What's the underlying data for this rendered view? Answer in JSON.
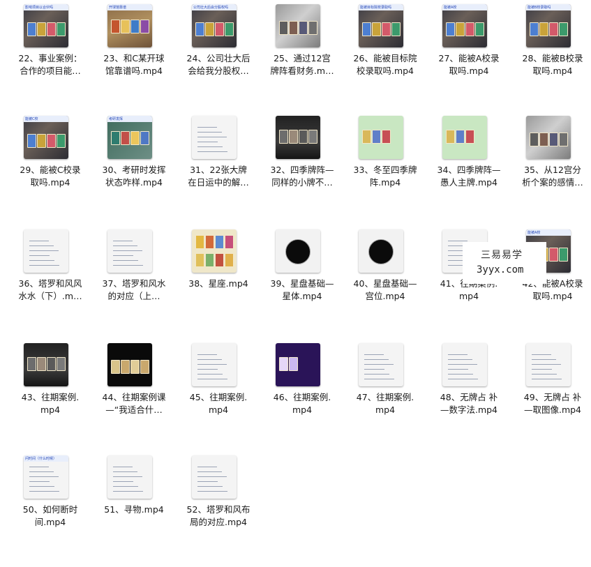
{
  "files": [
    {
      "l1": "22、事业案例：",
      "l2": "合作的项目能…",
      "thumb": "cards-blue",
      "banner": "影响项目以合伙吗"
    },
    {
      "l1": "23、和C某开球",
      "l2": "馆靠谱吗.mp4",
      "thumb": "cards-wood",
      "banner": "开球馆靠谱"
    },
    {
      "l1": "24、公司壮大后",
      "l2": "会给我分股权…",
      "thumb": "cards-blue",
      "banner": "公司壮大后会分股权吗"
    },
    {
      "l1": "25、通过12宫",
      "l2": "牌阵看财务.m…",
      "thumb": "photo-gray",
      "banner": ""
    },
    {
      "l1": "26、能被目标院",
      "l2": "校录取吗.mp4",
      "thumb": "cards-blue",
      "banner": "能被目标院校录取吗"
    },
    {
      "l1": "27、能被A校录",
      "l2": "取吗.mp4",
      "thumb": "cards-blue",
      "banner": "能被A校"
    },
    {
      "l1": "28、能被B校录",
      "l2": "取吗.mp4",
      "thumb": "cards-blue",
      "banner": "能被B校录取吗"
    },
    {
      "l1": "29、能被C校录",
      "l2": "取吗.mp4",
      "thumb": "cards-blue",
      "banner": "能被C校"
    },
    {
      "l1": "30、考研时发挥",
      "l2": "状态咋样.mp4",
      "thumb": "cards-green",
      "banner": "考研发挥"
    },
    {
      "l1": "31、22张大牌",
      "l2": "在日运中的解…",
      "thumb": "doc",
      "banner": ""
    },
    {
      "l1": "32、四季牌阵—",
      "l2": "同样的小牌不…",
      "thumb": "dark",
      "banner": ""
    },
    {
      "l1": "33、冬至四季牌",
      "l2": "阵.mp4",
      "thumb": "green",
      "banner": ""
    },
    {
      "l1": "34、四季牌阵—",
      "l2": "愚人主牌.mp4",
      "thumb": "green",
      "banner": ""
    },
    {
      "l1": "35、从12宫分",
      "l2": "析个案的感情…",
      "thumb": "photo-gray",
      "banner": ""
    },
    {
      "l1": "36、塔罗和风风",
      "l2": "水水（下）.m…",
      "thumb": "doc",
      "banner": ""
    },
    {
      "l1": "37、塔罗和风水",
      "l2": "的对应（上…",
      "thumb": "doc",
      "banner": ""
    },
    {
      "l1": "38、星座.mp4",
      "l2": "",
      "thumb": "cards-yellow",
      "banner": ""
    },
    {
      "l1": "39、星盘基础—",
      "l2": "星体.mp4",
      "thumb": "chart-dark",
      "banner": ""
    },
    {
      "l1": "40、星盘基础—",
      "l2": "宫位.mp4",
      "thumb": "chart-dark",
      "banner": ""
    },
    {
      "l1": "41、往期案例.",
      "l2": "mp4",
      "thumb": "doc",
      "banner": ""
    },
    {
      "l1": "42、能被A校录",
      "l2": "取吗.mp4",
      "thumb": "cards-blue",
      "banner": "能被A校"
    },
    {
      "l1": "43、往期案例.",
      "l2": "mp4",
      "thumb": "dark",
      "banner": ""
    },
    {
      "l1": "44、往期案例课",
      "l2": "—“我适合什…",
      "thumb": "black",
      "banner": ""
    },
    {
      "l1": "45、往期案例.",
      "l2": "mp4",
      "thumb": "doc",
      "banner": ""
    },
    {
      "l1": "46、往期案例.",
      "l2": "mp4",
      "thumb": "purple",
      "banner": ""
    },
    {
      "l1": "47、往期案例.",
      "l2": "mp4",
      "thumb": "doc",
      "banner": ""
    },
    {
      "l1": "48、无牌占 补",
      "l2": "—数字法.mp4",
      "thumb": "doc",
      "banner": ""
    },
    {
      "l1": "49、无牌占 补",
      "l2": "—取图像.mp4",
      "thumb": "doc",
      "banner": ""
    },
    {
      "l1": "50、如何断时",
      "l2": "间.mp4",
      "thumb": "doc",
      "banner": "问时间（什么时候）"
    },
    {
      "l1": "51、寻物.mp4",
      "l2": "",
      "thumb": "doc",
      "banner": ""
    },
    {
      "l1": "52、塔罗和风布",
      "l2": "局的对应.mp4",
      "thumb": "doc",
      "banner": ""
    }
  ],
  "watermark": {
    "line1": "三易易学",
    "line2": "3yyx.com"
  },
  "colors": {
    "label": "#1a1a1a",
    "background": "#ffffff",
    "banner_text": "#2447b8"
  }
}
